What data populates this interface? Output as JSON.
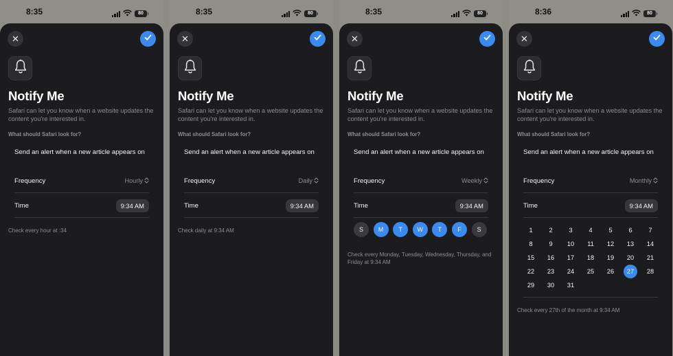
{
  "screens": [
    {
      "status_time": "8:35",
      "battery": "80",
      "title": "Notify Me",
      "subtitle": "Safari can let you know when a website updates the content you're interested in.",
      "section_label": "What should Safari look for?",
      "alert_text": "Send an alert when a new article appears on",
      "frequency_label": "Frequency",
      "frequency_value": "Hourly",
      "time_label": "Time",
      "time_value": "9:34 AM",
      "footnote": "Check every hour at :34"
    },
    {
      "status_time": "8:35",
      "battery": "80",
      "title": "Notify Me",
      "subtitle": "Safari can let you know when a website updates the content you're interested in.",
      "section_label": "What should Safari look for?",
      "alert_text": "Send an alert when a new article appears on",
      "frequency_label": "Frequency",
      "frequency_value": "Daily",
      "time_label": "Time",
      "time_value": "9:34 AM",
      "footnote": "Check daily at 9:34 AM"
    },
    {
      "status_time": "8:35",
      "battery": "80",
      "title": "Notify Me",
      "subtitle": "Safari can let you know when a website updates the content you're interested in.",
      "section_label": "What should Safari look for?",
      "alert_text": "Send an alert when a new article appears on",
      "frequency_label": "Frequency",
      "frequency_value": "Weekly",
      "time_label": "Time",
      "time_value": "9:34 AM",
      "weekdays": [
        {
          "label": "S",
          "selected": false
        },
        {
          "label": "M",
          "selected": true
        },
        {
          "label": "T",
          "selected": true
        },
        {
          "label": "W",
          "selected": true
        },
        {
          "label": "T",
          "selected": true
        },
        {
          "label": "F",
          "selected": true
        },
        {
          "label": "S",
          "selected": false
        }
      ],
      "footnote": "Check every Monday, Tuesday, Wednesday, Thursday, and Friday at 9:34 AM"
    },
    {
      "status_time": "8:36",
      "battery": "80",
      "title": "Notify Me",
      "subtitle": "Safari can let you know when a website updates the content you're interested in.",
      "section_label": "What should Safari look for?",
      "alert_text": "Send an alert when a new article appears on",
      "frequency_label": "Frequency",
      "frequency_value": "Monthly",
      "time_label": "Time",
      "time_value": "9:34 AM",
      "calendar_days": [
        "1",
        "2",
        "3",
        "4",
        "5",
        "6",
        "7",
        "8",
        "9",
        "10",
        "11",
        "12",
        "13",
        "14",
        "15",
        "16",
        "17",
        "18",
        "19",
        "20",
        "21",
        "22",
        "23",
        "24",
        "25",
        "26",
        "27",
        "28",
        "29",
        "30",
        "31"
      ],
      "selected_day": "27",
      "footnote": "Check every 27th of the month at 9:34 AM"
    }
  ],
  "colors": {
    "accent": "#3a8af0",
    "sheet_background": "#1c1c1e",
    "secondary_text": "#8d8d92"
  },
  "icons": {
    "close": "close-icon",
    "done": "checkmark-icon",
    "app": "bell-icon",
    "popup": "chevron-up-down-icon"
  }
}
